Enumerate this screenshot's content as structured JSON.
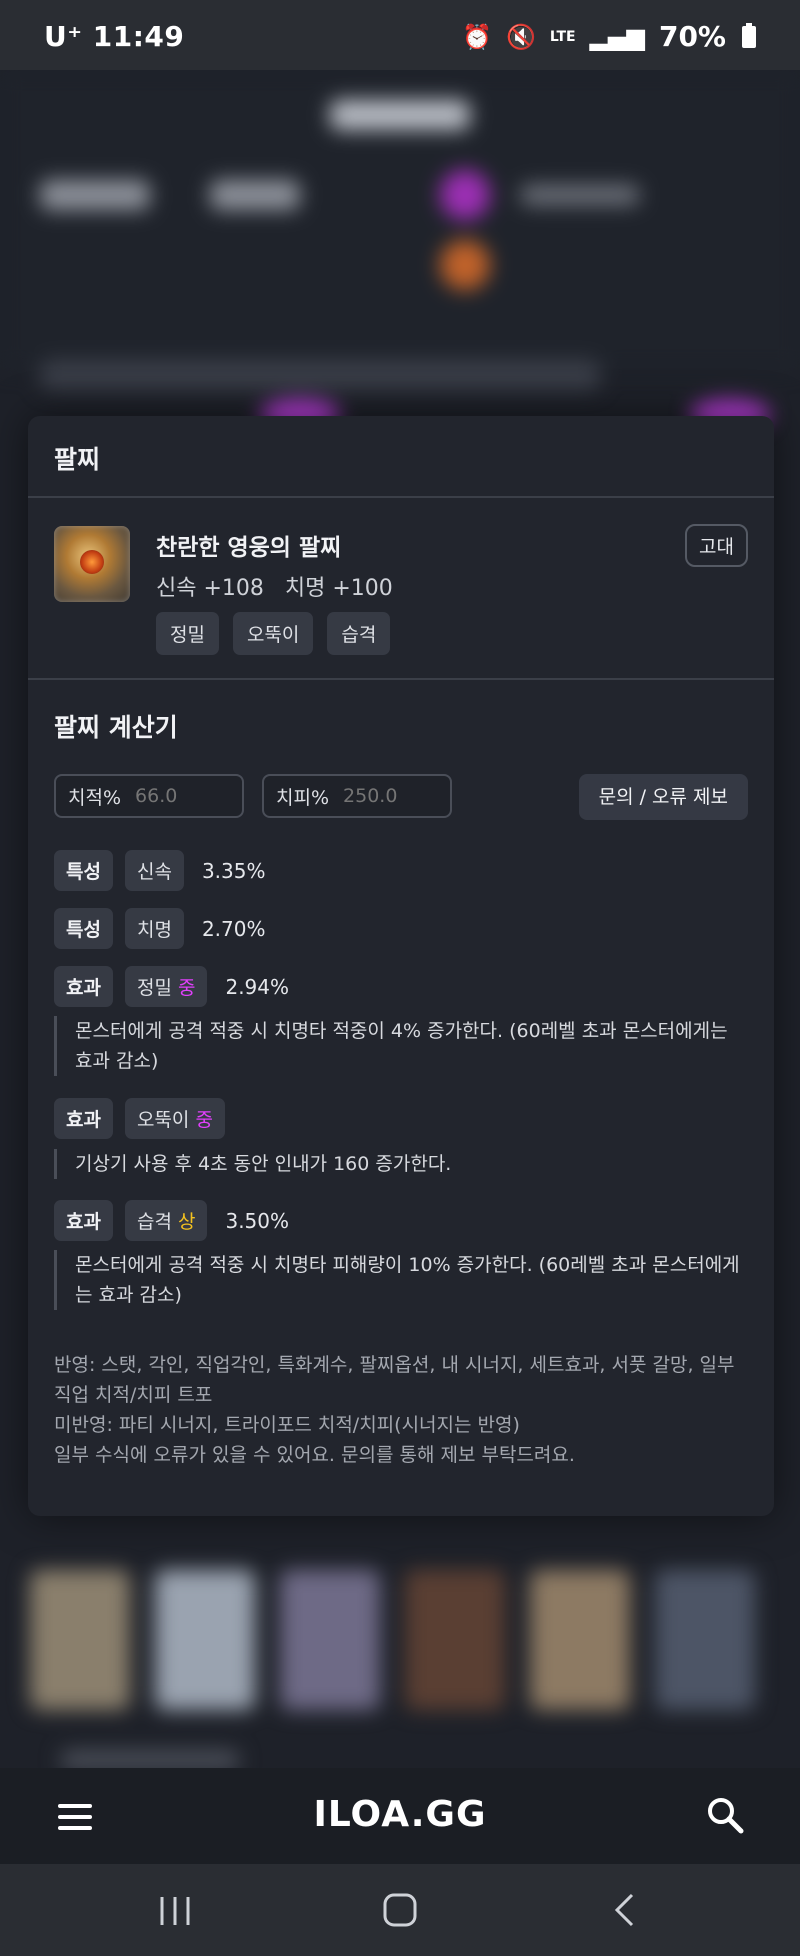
{
  "status_bar": {
    "carrier": "U⁺",
    "time": "11:49",
    "battery": "70%",
    "network": "LTE"
  },
  "card": {
    "title": "팔찌",
    "item": {
      "name": "찬란한 영웅의 팔찌",
      "stats": "신속 +108   치명 +100",
      "tier": "고대",
      "tags": [
        "정밀",
        "오뚝이",
        "습격"
      ]
    },
    "calculator": {
      "title": "팔찌 계산기",
      "crit_rate_label": "치적%",
      "crit_rate_placeholder": "66.0",
      "crit_dmg_label": "치피%",
      "crit_dmg_placeholder": "250.0",
      "report_button": "문의 / 오류 제보",
      "rows": [
        {
          "kind": "특성",
          "name": "신속",
          "grade": "",
          "value": "3.35%"
        },
        {
          "kind": "특성",
          "name": "치명",
          "grade": "",
          "value": "2.70%"
        },
        {
          "kind": "효과",
          "name": "정밀",
          "grade": "중",
          "value": "2.94%",
          "desc": "몬스터에게 공격 적중 시 치명타 적중이 4% 증가한다. (60레벨 초과 몬스터에게는 효과 감소)"
        },
        {
          "kind": "효과",
          "name": "오뚝이",
          "grade": "중",
          "value": "",
          "desc": "기상기 사용 후 4초 동안 인내가 160 증가한다."
        },
        {
          "kind": "효과",
          "name": "습격",
          "grade": "상",
          "value": "3.50%",
          "desc": "몬스터에게 공격 적중 시 치명타 피해량이 10% 증가한다. (60레벨 초과 몬스터에게는 효과 감소)"
        }
      ],
      "notes": [
        "반영: 스탯, 각인, 직업각인, 특화계수, 팔찌옵션, 내 시너지, 세트효과, 서풋 갈망, 일부 직업 치적/치피 트포",
        "미반영: 파티 시너지, 트라이포드 치적/치피(시너지는 반영)",
        "일부 수식에 오류가 있을 수 있어요. 문의를 통해 제보 부탁드려요."
      ]
    }
  },
  "bottom_nav": {
    "logo": "ILOA.GG",
    "menu_icon": "hamburger-menu-icon",
    "search_icon": "search-icon"
  },
  "colors": {
    "grade_mid": "#e040fb",
    "grade_high": "#f4c21f",
    "card_bg": "#22252d"
  }
}
